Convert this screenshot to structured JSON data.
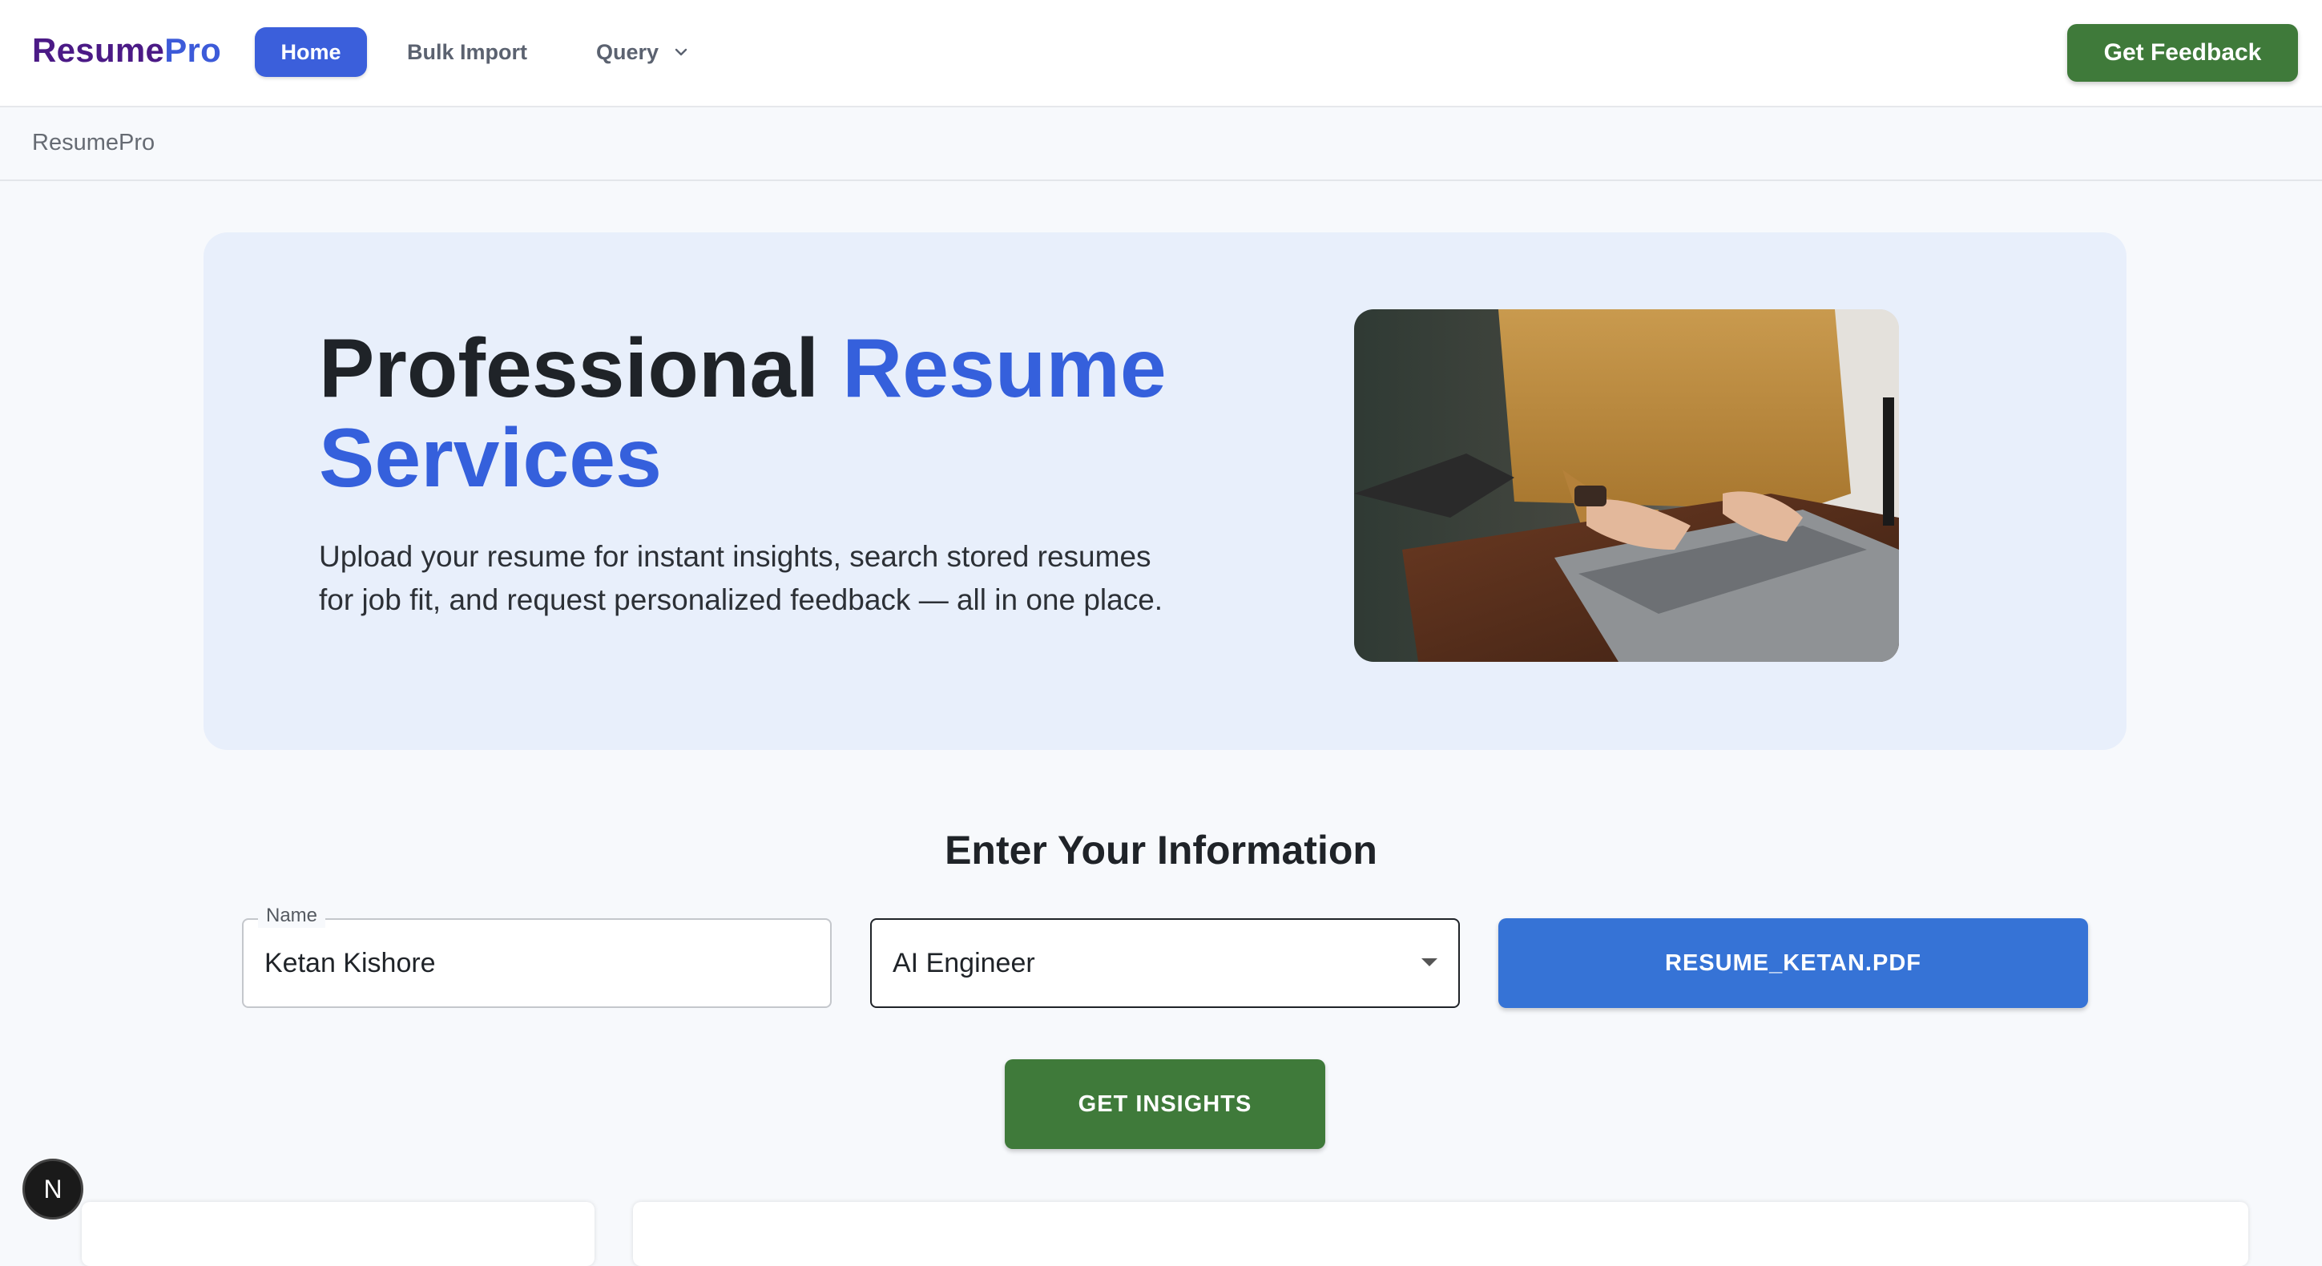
{
  "brand": {
    "part1": "Resume",
    "part2": "Pro"
  },
  "nav": {
    "home": "Home",
    "bulk_import": "Bulk Import",
    "query": "Query",
    "feedback_button": "Get Feedback"
  },
  "breadcrumb": "ResumePro",
  "hero": {
    "title_plain": "Professional ",
    "title_accent_1": "Resume",
    "title_accent_2": "Services",
    "subtitle_line1": "Upload your resume for instant insights, search stored resumes",
    "subtitle_line2": "for job fit, and request personalized feedback — all in one place."
  },
  "form": {
    "title": "Enter Your Information",
    "name_label": "Name",
    "name_value": "Ketan Kishore",
    "role_value": "AI Engineer",
    "file_button": "RESUME_KETAN.PDF",
    "submit_button": "GET INSIGHTS"
  },
  "dev_badge": "N",
  "colors": {
    "primary_blue": "#3b5fdb",
    "accent_blue": "#3560dc",
    "file_button_blue": "#3673d6",
    "green": "#3f7a3a",
    "brand_purple": "#4b1a86",
    "hero_bg": "#e8effb"
  }
}
